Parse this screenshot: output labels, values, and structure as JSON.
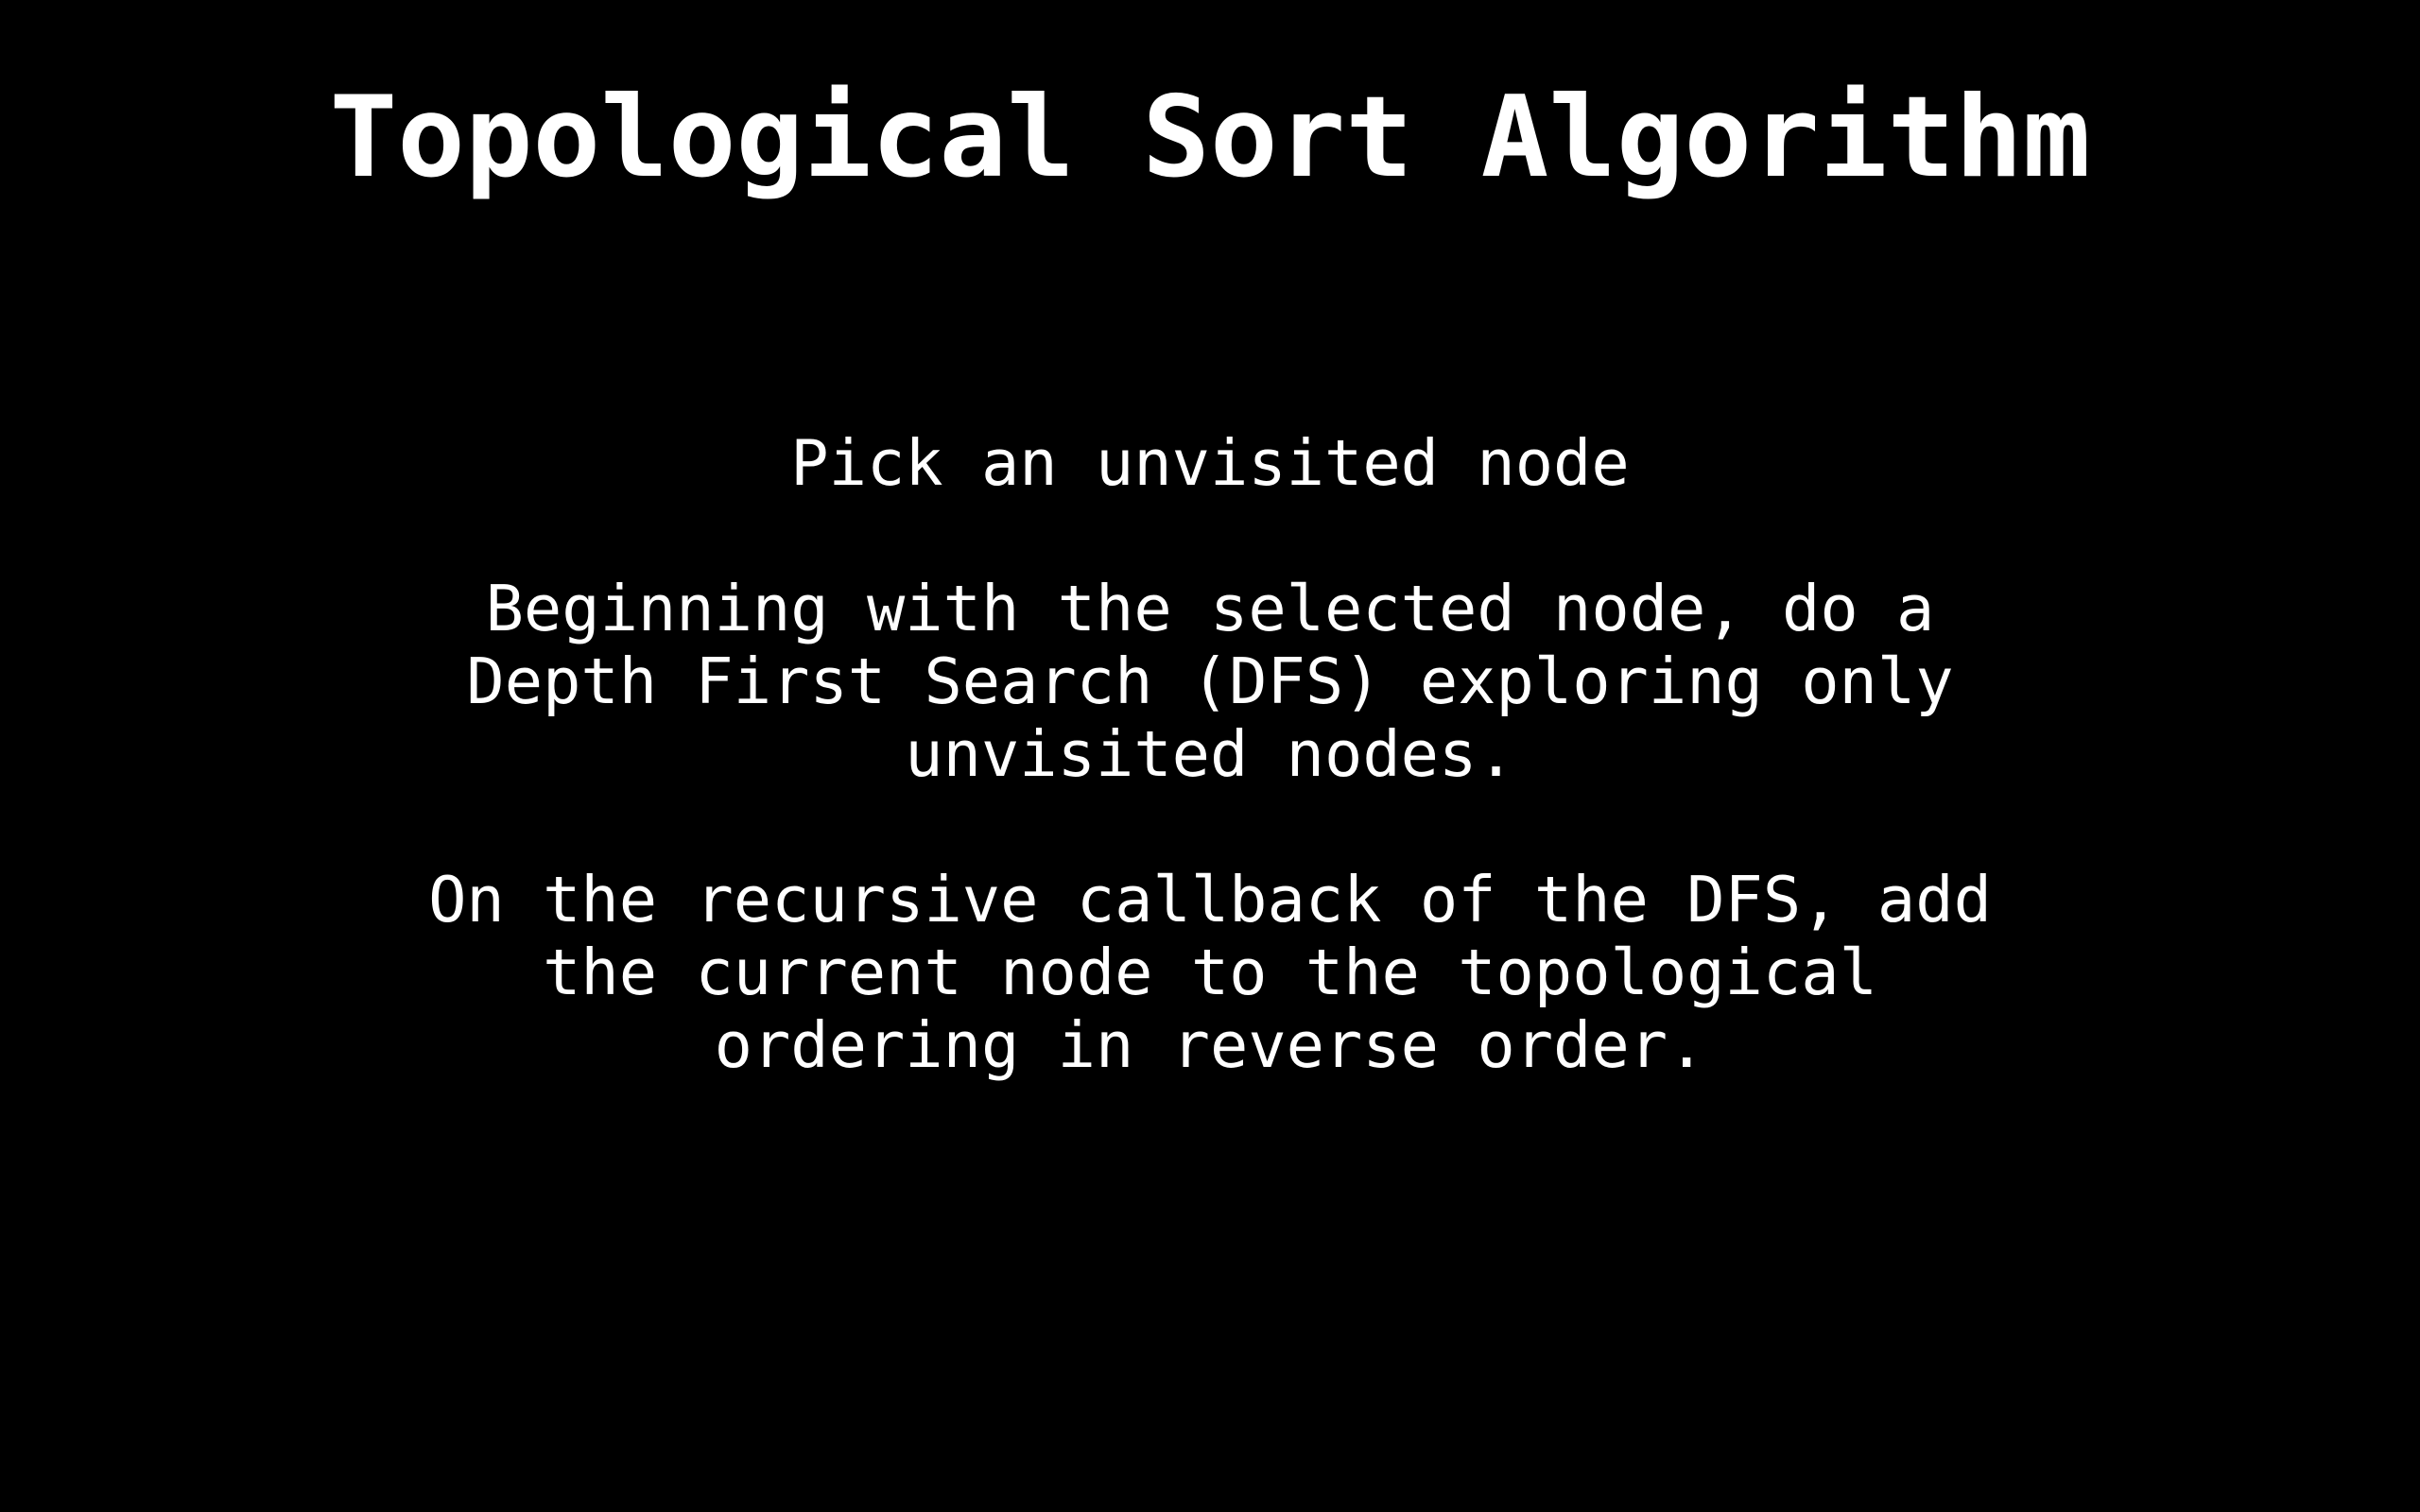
{
  "slide": {
    "title": "Topological Sort Algorithm",
    "paragraphs": [
      {
        "lines": [
          "Pick an unvisited node"
        ]
      },
      {
        "lines": [
          "Beginning with the selected node, do a",
          "Depth First Search (DFS) exploring only",
          "unvisited nodes."
        ]
      },
      {
        "lines": [
          "On the recursive callback of the DFS, add",
          "the current node to the topological",
          "ordering in reverse order."
        ]
      }
    ]
  },
  "colors": {
    "background": "#000000",
    "text": "#ffffff"
  }
}
